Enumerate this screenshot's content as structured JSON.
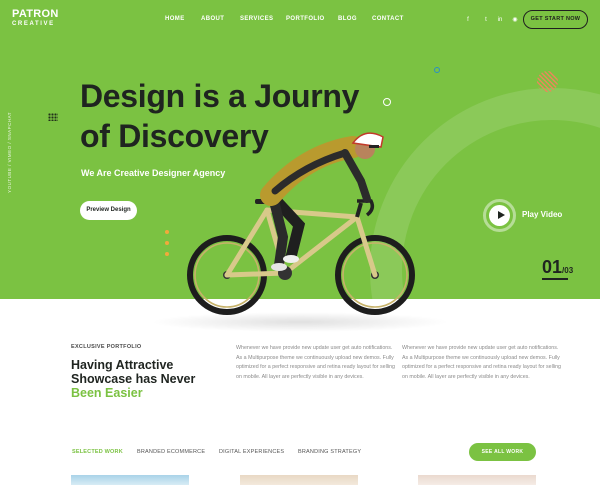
{
  "brand": {
    "line1": "PATRON",
    "line2": "CREATIVE"
  },
  "nav": {
    "items": [
      {
        "label": "HOME"
      },
      {
        "label": "ABOUT"
      },
      {
        "label": "SERVICES"
      },
      {
        "label": "PORTFOLIO"
      },
      {
        "label": "BLOG"
      },
      {
        "label": "CONTACT"
      }
    ],
    "social_icons": [
      "facebook-icon",
      "twitter-icon",
      "linkedin-icon",
      "rss-icon"
    ],
    "social_glyphs": [
      "f",
      "t",
      "in",
      "◉"
    ],
    "cta_label": "GET START NOW"
  },
  "hero": {
    "title_line1": "Design is a Journy",
    "title_line2": "of Discovery",
    "subtitle": "We Are Creative Designer Agency",
    "button_label": "Preview Design",
    "play_label": "Play Video",
    "slide_current": "01",
    "slide_total": "/03",
    "social_vertical": "YOUTUBE / VIMEO / SNAPCHAT"
  },
  "about": {
    "eyebrow": "EXCLUSIVE PORTFOLIO",
    "heading_line1": "Having Attractive",
    "heading_line2": "Showcase has Never",
    "heading_line3": "Been Easier",
    "col1": "Whenever we have provide new update user get auto notifications. As a Multipurpose theme we continuously upload new demos. Fully optimized for a perfect responsive and retina ready layout for selling on mobile. All layer are perfectly visible in any devices.",
    "col2": "Whenever we have provide new update user get auto notifications. As a Multipurpose theme we continuously upload new demos. Fully optimized for a perfect responsive and retina ready layout for selling on mobile. All layer are perfectly visible in any devices."
  },
  "portfolio": {
    "tabs": [
      {
        "label": "SELECTED WORK",
        "active": true
      },
      {
        "label": "BRANDED ECOMMERCE",
        "active": false
      },
      {
        "label": "DIGITAL EXPERIENCES",
        "active": false
      },
      {
        "label": "BRANDING STRATEGY",
        "active": false
      }
    ],
    "see_all_label": "SEE ALL WORK"
  },
  "colors": {
    "accent": "#7bc242",
    "dark": "#1f2420",
    "yellow": "#f2a93b",
    "coral": "#e8895a",
    "blue": "#2a8fc5"
  }
}
